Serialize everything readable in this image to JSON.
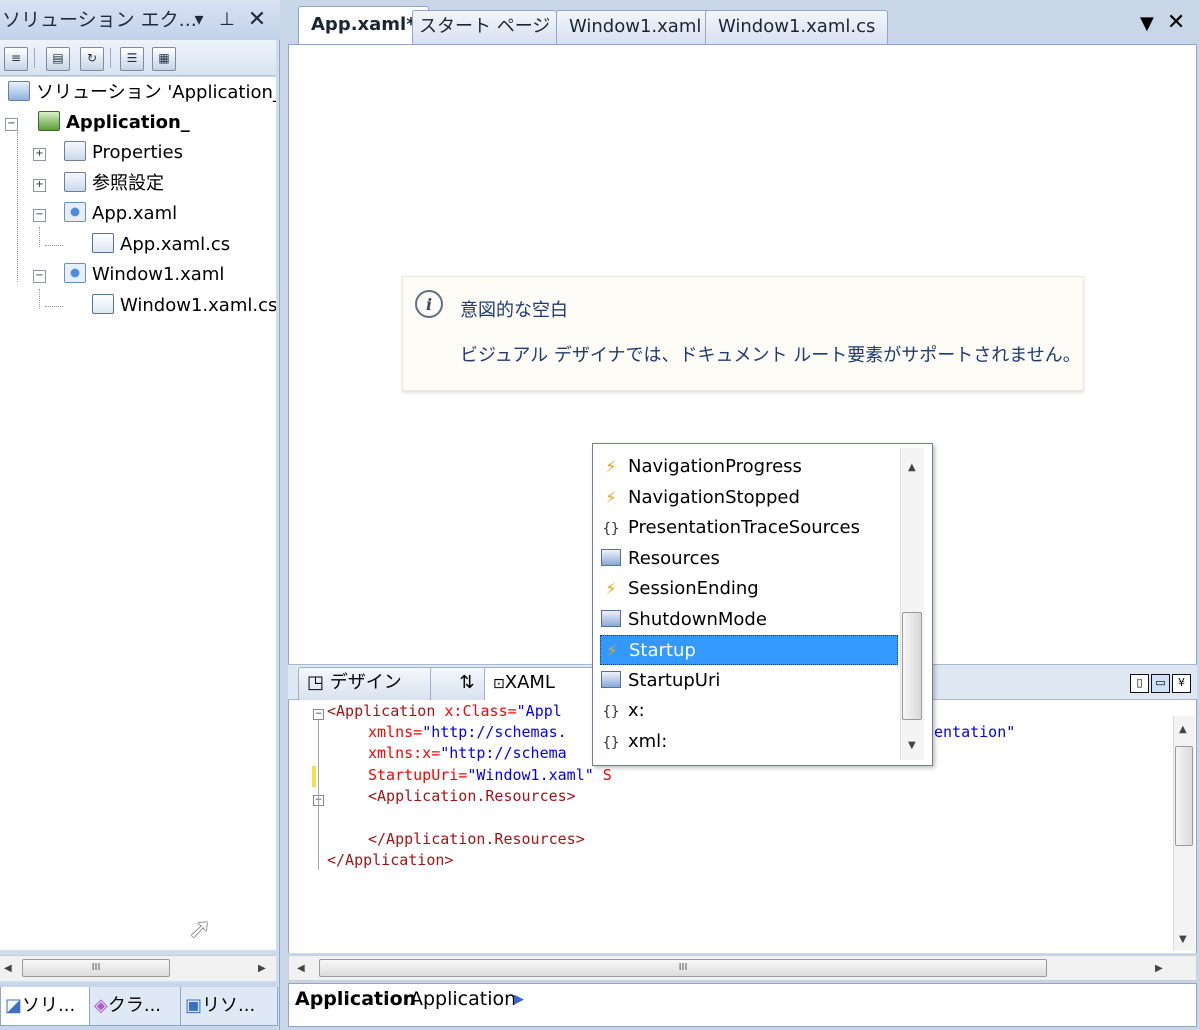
{
  "solution_explorer": {
    "title": "ソリューション エク...",
    "tree": [
      {
        "label": "ソリューション 'Application_'"
      },
      {
        "label": "Application_"
      },
      {
        "label": "Properties"
      },
      {
        "label": "参照設定"
      },
      {
        "label": "App.xaml"
      },
      {
        "label": "App.xaml.cs"
      },
      {
        "label": "Window1.xaml"
      },
      {
        "label": "Window1.xaml.cs"
      }
    ],
    "hscroll_grip": "III",
    "bottom_tabs": [
      {
        "label": "ソリ..."
      },
      {
        "label": "クラ..."
      },
      {
        "label": "リソ..."
      }
    ]
  },
  "document_tabs": [
    {
      "label": "App.xaml*",
      "active": true
    },
    {
      "label": "スタート ページ"
    },
    {
      "label": "Window1.xaml"
    },
    {
      "label": "Window1.xaml.cs"
    }
  ],
  "designer": {
    "info_title": "意図的な空白",
    "info_message": "ビジュアル デザイナでは、ドキュメント ルート要素がサポートされません。"
  },
  "split_tabs": {
    "design": "デザイン",
    "swap": "⇅",
    "xaml": "XAML"
  },
  "code_lines": [
    {
      "tag": "<Application ",
      "attr": "x:Class=",
      "val": "\"Appl"
    },
    {
      "attr": "xmlns=",
      "val": "\"http://schemas.",
      "tail": "entation\""
    },
    {
      "attr": "xmlns:x=",
      "val": "\"http://schema"
    },
    {
      "attr": "StartupUri=",
      "val": "\"Window1.xaml\"",
      "typed": " S"
    },
    {
      "tag": "<Application.Resources>"
    },
    {
      "tag": ""
    },
    {
      "tag": "</Application.Resources>"
    },
    {
      "tag": "</Application>"
    }
  ],
  "intellisense": {
    "items": [
      {
        "label": "NavigationProgress",
        "icon": "event-icon"
      },
      {
        "label": "NavigationStopped",
        "icon": "event-icon"
      },
      {
        "label": "PresentationTraceSources",
        "icon": "namespace-icon"
      },
      {
        "label": "Resources",
        "icon": "property-icon"
      },
      {
        "label": "SessionEnding",
        "icon": "event-icon"
      },
      {
        "label": "ShutdownMode",
        "icon": "property-icon"
      },
      {
        "label": "Startup",
        "icon": "event-icon",
        "selected": true
      },
      {
        "label": "StartupUri",
        "icon": "property-icon"
      },
      {
        "label": "x:",
        "icon": "namespace-icon"
      },
      {
        "label": "xml:",
        "icon": "namespace-icon"
      }
    ]
  },
  "editor_hscroll_grip": "III",
  "breadcrumb": {
    "element": "Application",
    "name": "Application"
  },
  "colors": {
    "selection": "#3399ff",
    "xaml_tag": "#a31515",
    "xaml_attr": "#ff0000",
    "xaml_value": "#0000ff",
    "event_icon": "#e8a41a"
  }
}
